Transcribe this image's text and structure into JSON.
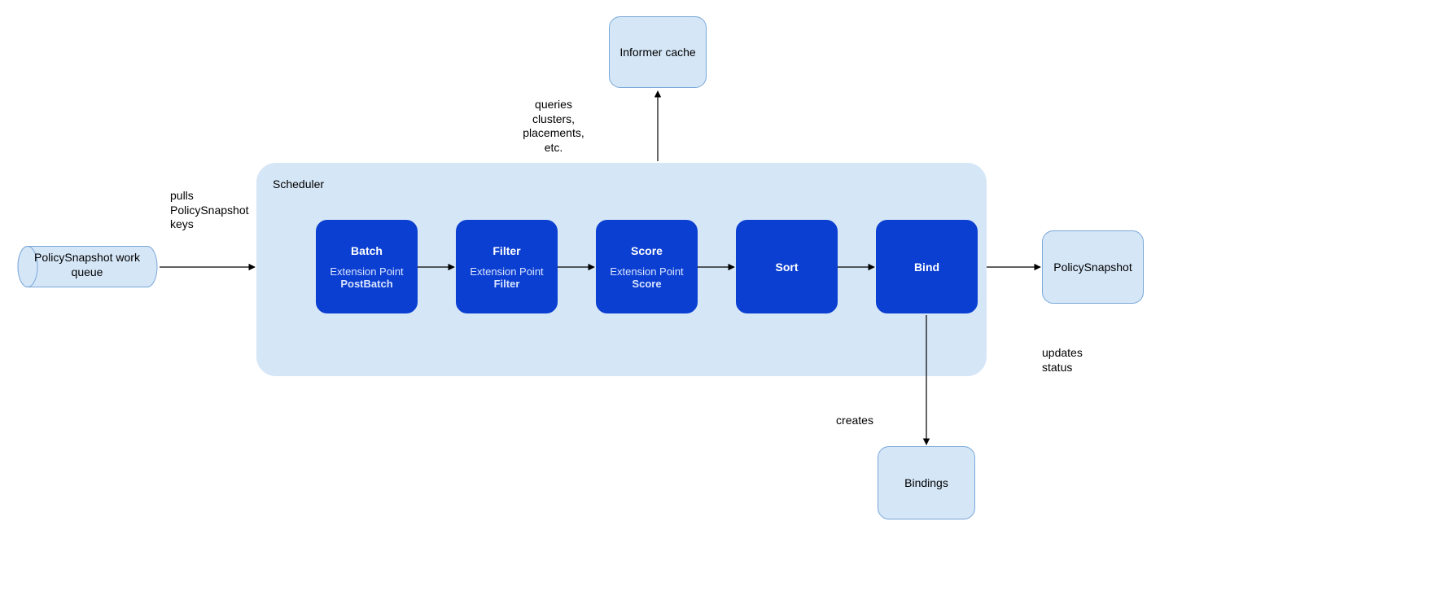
{
  "nodes": {
    "informer": "Informer cache",
    "policySnapshot": "PolicySnapshot",
    "bindings": "Bindings",
    "workQueue": "PolicySnapshot work\nqueue"
  },
  "scheduler": {
    "title": "Scheduler",
    "steps": {
      "batch": {
        "title": "Batch",
        "extLabel": "Extension Point",
        "extName": "PostBatch"
      },
      "filter": {
        "title": "Filter",
        "extLabel": "Extension Point",
        "extName": "Filter"
      },
      "score": {
        "title": "Score",
        "extLabel": "Extension Point",
        "extName": "Score"
      },
      "sort": {
        "title": "Sort"
      },
      "bind": {
        "title": "Bind"
      }
    }
  },
  "edges": {
    "pulls": "pulls\nPolicySnapshot\nkeys",
    "queries": "queries\nclusters,\nplacements,\netc.",
    "updates": "updates\nstatus",
    "creates": "creates"
  }
}
